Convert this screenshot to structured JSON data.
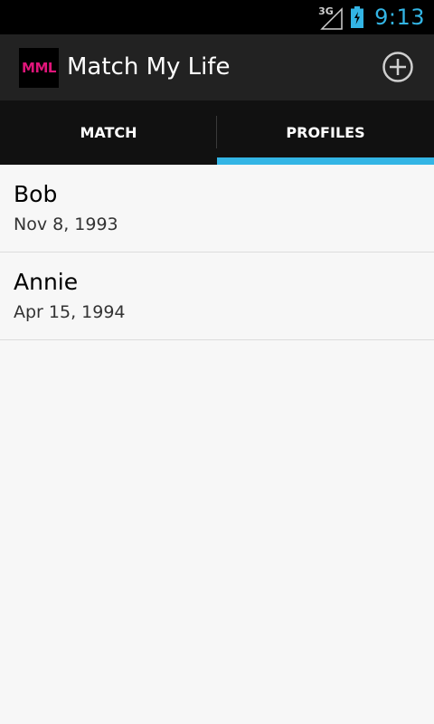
{
  "status_bar": {
    "network_label": "3G",
    "time": "9:13",
    "accent_color": "#33b5e5",
    "icons": [
      "signal-icon",
      "battery-charging-icon"
    ]
  },
  "action_bar": {
    "logo_text": "MML",
    "logo_color": "#e0157a",
    "title": "Match My Life",
    "add_icon": "add-circle-icon"
  },
  "tabs": [
    {
      "label": "MATCH",
      "selected": false
    },
    {
      "label": "PROFILES",
      "selected": true
    }
  ],
  "profiles": [
    {
      "name": "Bob",
      "date": "Nov 8, 1993"
    },
    {
      "name": "Annie",
      "date": "Apr 15, 1994"
    }
  ]
}
